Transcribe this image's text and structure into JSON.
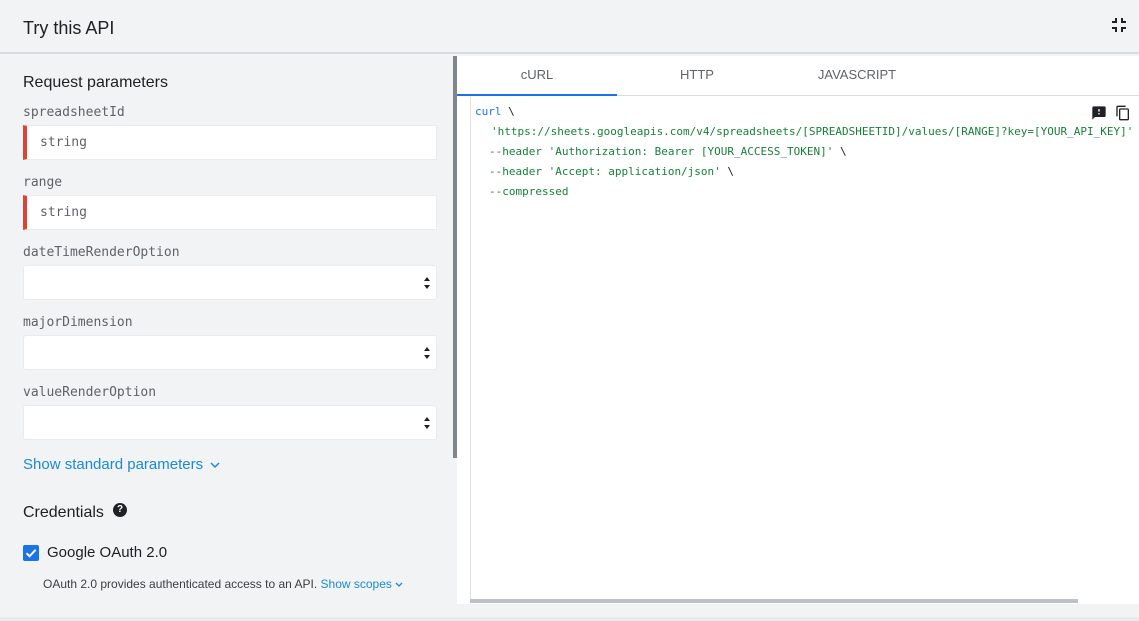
{
  "header": {
    "title": "Try this API"
  },
  "params": {
    "section_title": "Request parameters",
    "spreadsheetId": {
      "label": "spreadsheetId",
      "placeholder": "string"
    },
    "range": {
      "label": "range",
      "placeholder": "string"
    },
    "dateTimeRenderOption": {
      "label": "dateTimeRenderOption",
      "value": ""
    },
    "majorDimension": {
      "label": "majorDimension",
      "value": ""
    },
    "valueRenderOption": {
      "label": "valueRenderOption",
      "value": ""
    },
    "show_standard": "Show standard parameters"
  },
  "credentials": {
    "title": "Credentials",
    "help_glyph": "?",
    "oauth_label": "Google OAuth 2.0",
    "oauth_checked": true,
    "oauth_desc": "OAuth 2.0 provides authenticated access to an API.",
    "show_scopes": "Show scopes"
  },
  "tabs": [
    "cURL",
    "HTTP",
    "JAVASCRIPT"
  ],
  "active_tab": "cURL",
  "code": {
    "line1_kw": "curl",
    "line1_rest": " \\",
    "line2": "'https://sheets.googleapis.com/v4/spreadsheets/[SPREADSHEETID]/values/[RANGE]?key=[YOUR_API_KEY]'",
    "line3_kw": "--header ",
    "line3_str": "'Authorization: Bearer [YOUR_ACCESS_TOKEN]'",
    "line3_end": " \\",
    "line4_kw": "--header ",
    "line4_str": "'Accept: application/json'",
    "line4_end": " \\",
    "line5": "--compressed"
  },
  "colors": {
    "accent": "#1a73e8",
    "required": "#db4437",
    "code_string": "#188038"
  },
  "icons": {
    "collapse": "fullscreen-exit-icon",
    "feedback": "feedback-icon",
    "copy": "copy-icon"
  }
}
